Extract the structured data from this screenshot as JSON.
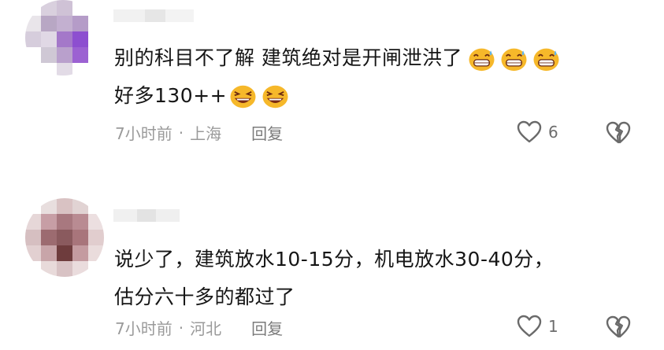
{
  "comments": [
    {
      "text_line1": "别的科目不了解  建筑绝对是开闸泄洪了",
      "text_line2": "好多130++",
      "emoji_line1": [
        "sweat-grin-emoji",
        "sweat-grin-emoji",
        "sweat-grin-emoji"
      ],
      "emoji_line2": [
        "laughing-emoji",
        "laughing-emoji"
      ],
      "time": "7小时前",
      "separator": "·",
      "location": "上海",
      "reply_label": "回复",
      "like_count": "6"
    },
    {
      "text_line1": "说少了，建筑放水10-15分，机电放水30-40分，",
      "text_line2": "估分六十多的都过了",
      "time": "7小时前",
      "separator": "·",
      "location": "河北",
      "reply_label": "回复",
      "like_count": "1"
    }
  ],
  "colors": {
    "text": "#161616",
    "meta": "#9a9a9a",
    "emoji_face": "#f6b82a",
    "emoji_mouth": "#6b2a10"
  }
}
